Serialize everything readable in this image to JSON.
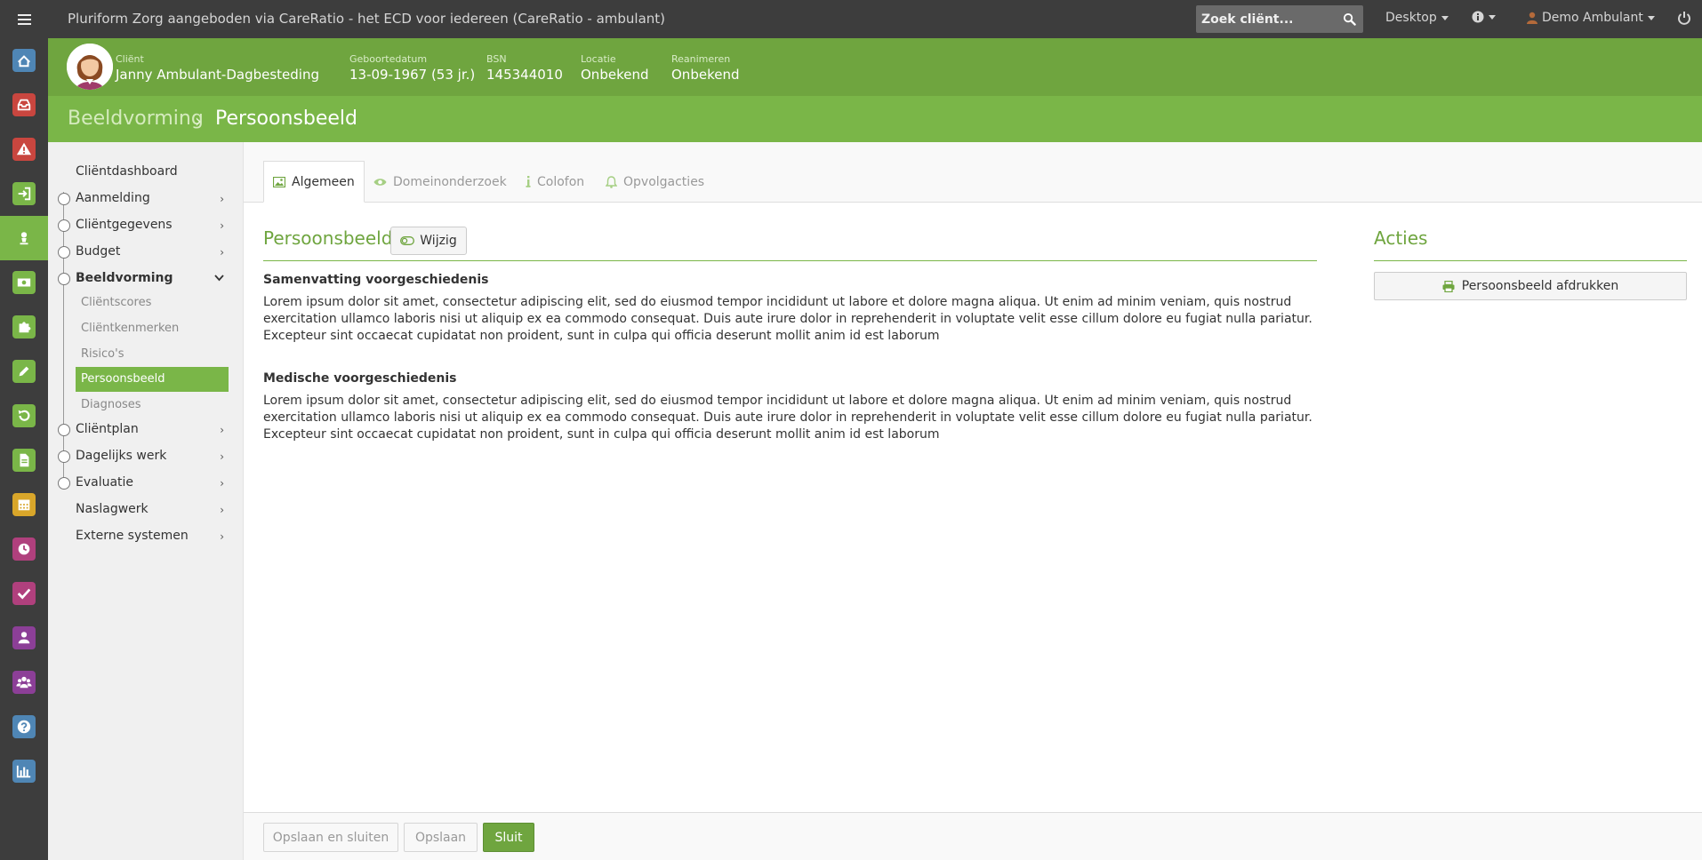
{
  "app": {
    "title": "Pluriform Zorg aangeboden via CareRatio - het ECD voor iedereen  (CareRatio - ambulant)",
    "search_placeholder": "Zoek cliënt...",
    "desktop_label": "Desktop",
    "user_label": "Demo Ambulant"
  },
  "rail": [
    {
      "icon": "home-icon",
      "color": "#4f86b5"
    },
    {
      "icon": "inbox-icon",
      "color": "#c9463f"
    },
    {
      "icon": "warning-icon",
      "color": "#c9463f"
    },
    {
      "icon": "sign-in-icon",
      "color": "#7ab648"
    },
    {
      "icon": "user-icon",
      "color": "#7ab648"
    },
    {
      "icon": "money-icon",
      "color": "#7ab648"
    },
    {
      "icon": "puzzle-icon",
      "color": "#7ab648"
    },
    {
      "icon": "pencil-icon",
      "color": "#7ab648"
    },
    {
      "icon": "undo-icon",
      "color": "#7ab648"
    },
    {
      "icon": "document-icon",
      "color": "#7ab648"
    },
    {
      "icon": "calendar-icon",
      "color": "#d9a62a"
    },
    {
      "icon": "clock-icon",
      "color": "#b0407d"
    },
    {
      "icon": "check-icon",
      "color": "#b0407d"
    },
    {
      "icon": "person-icon",
      "color": "#8c3f97"
    },
    {
      "icon": "group-icon",
      "color": "#8c3f97"
    },
    {
      "icon": "help-icon",
      "color": "#4f86b5"
    },
    {
      "icon": "chart-icon",
      "color": "#4f86b5"
    }
  ],
  "client": {
    "client_label": "Cliënt",
    "client_name": "Janny Ambulant-Dagbesteding",
    "dob_label": "Geboortedatum",
    "dob": "13-09-1967 (53 jr.)",
    "bsn_label": "BSN",
    "bsn": "145344010",
    "location_label": "Locatie",
    "location": "Onbekend",
    "resus_label": "Reanimeren",
    "resus": "Onbekend"
  },
  "breadcrumb": {
    "parent": "Beeldvorming",
    "current": "Persoonsbeeld"
  },
  "nav": {
    "dashboard": "Cliëntdashboard",
    "aanmelding": "Aanmelding",
    "clientgegevens": "Cliëntgegevens",
    "budget": "Budget",
    "beeldvorming": "Beeldvorming",
    "sub_clientscores": "Cliëntscores",
    "sub_clientkenmerken": "Cliëntkenmerken",
    "sub_risicos": "Risico's",
    "sub_persoonsbeeld": "Persoonsbeeld",
    "sub_diagnoses": "Diagnoses",
    "clientplan": "Cliëntplan",
    "dagelijks": "Dagelijks werk",
    "evaluatie": "Evaluatie",
    "naslagwerk": "Naslagwerk",
    "extern": "Externe systemen"
  },
  "tabs": {
    "algemeen": "Algemeen",
    "domeinonderzoek": "Domeinonderzoek",
    "colofon": "Colofon",
    "opvolgacties": "Opvolgacties"
  },
  "main": {
    "title": "Persoonsbeeld",
    "edit_label": "Wijzig",
    "section1_title": "Samenvatting voorgeschiedenis",
    "section1_body": "Lorem ipsum dolor sit amet, consectetur adipiscing elit, sed do eiusmod tempor incididunt ut labore et dolore magna aliqua. Ut enim ad minim veniam, quis nostrud exercitation ullamco laboris nisi ut aliquip ex ea commodo consequat. Duis aute irure dolor in reprehenderit in voluptate velit esse cillum dolore eu fugiat nulla pariatur. Excepteur sint occaecat cupidatat non proident, sunt in culpa qui officia deserunt mollit anim id est laborum",
    "section2_title": "Medische voorgeschiedenis",
    "section2_body": "Lorem ipsum dolor sit amet, consectetur adipiscing elit, sed do eiusmod tempor incididunt ut labore et dolore magna aliqua. Ut enim ad minim veniam, quis nostrud exercitation ullamco laboris nisi ut aliquip ex ea commodo consequat. Duis aute irure dolor in reprehenderit in voluptate velit esse cillum dolore eu fugiat nulla pariatur. Excepteur sint occaecat cupidatat non proident, sunt in culpa qui officia deserunt mollit anim id est laborum"
  },
  "acties": {
    "title": "Acties",
    "print_label": "Persoonsbeeld afdrukken"
  },
  "footer": {
    "save_close": "Opslaan en sluiten",
    "save": "Opslaan",
    "close": "Sluit"
  },
  "colors": {
    "accent": "#7ab648",
    "accent_dark": "#6fa53f",
    "topbar": "#3d3d3d"
  }
}
